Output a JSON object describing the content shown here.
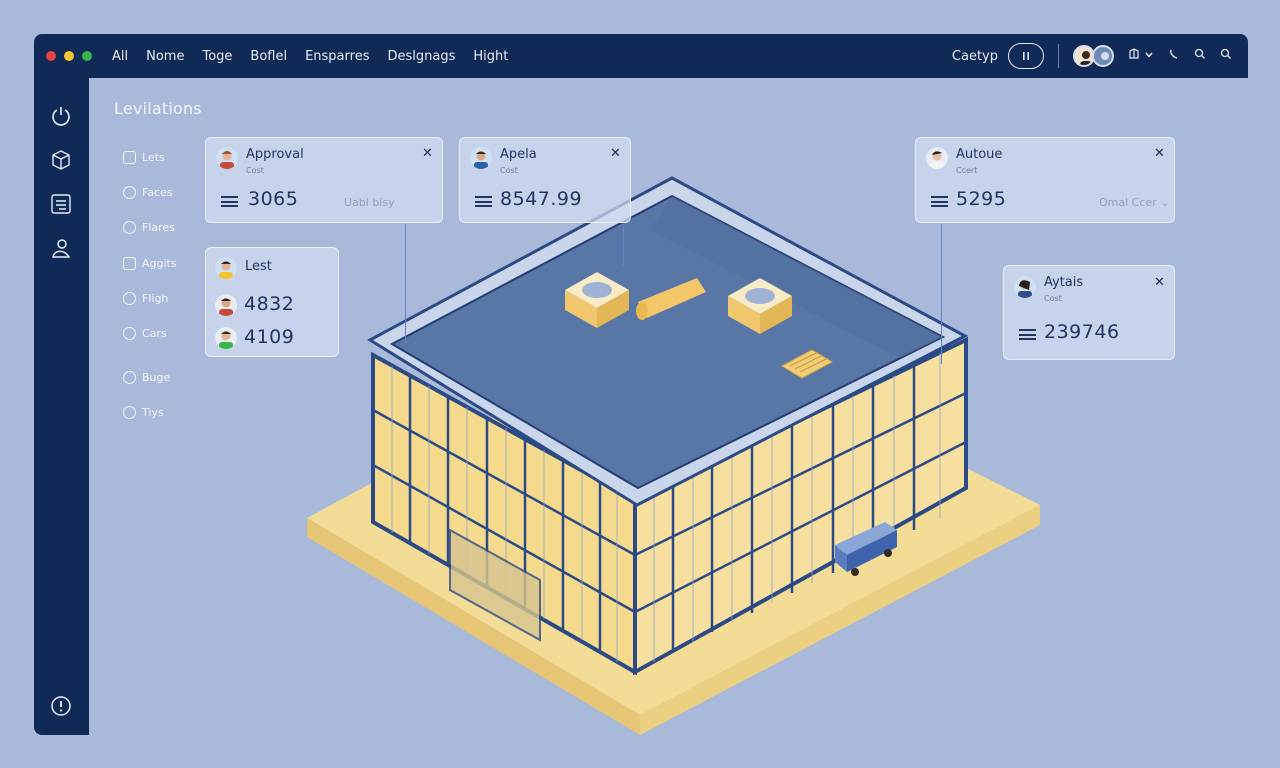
{
  "window": {
    "traffic_lights": [
      "#e2453c",
      "#f2c530",
      "#39b54a"
    ]
  },
  "topnav": {
    "items": [
      "All",
      "Nome",
      "Toge",
      "Boflel",
      "Ensparres",
      "Deslgnags",
      "Hight"
    ]
  },
  "toolbar": {
    "label": "Caetyp",
    "pause_icon": "pause-icon",
    "icons": [
      "grid-icon",
      "chevron-down-icon",
      "phone-icon",
      "search-icon",
      "search-icon"
    ]
  },
  "sidebar": {
    "icons": [
      "power-icon",
      "cube-icon",
      "layers-icon",
      "user-icon"
    ],
    "bottom_icon": "info-icon"
  },
  "panel": {
    "title": "Levilations",
    "items": [
      {
        "label": "Lets",
        "icon": "square-icon"
      },
      {
        "label": "Faces",
        "icon": "circle-icon"
      },
      {
        "label": "Flares",
        "icon": "circle-icon"
      },
      {
        "label": "Aggits",
        "icon": "square-icon"
      },
      {
        "label": "Fligh",
        "icon": "circle-icon"
      },
      {
        "label": "Cars",
        "icon": "circle-icon"
      },
      {
        "label": "Buge",
        "icon": "circle-icon"
      },
      {
        "label": "Tiys",
        "icon": "circle-icon"
      }
    ]
  },
  "cards": {
    "approval": {
      "name": "Approval",
      "sub": "Cost",
      "value": "3065",
      "faint": "Uabl bisy"
    },
    "apela": {
      "name": "Apela",
      "sub": "Cost",
      "value": "8547.99"
    },
    "autoue": {
      "name": "Autoue",
      "sub": "Ccert",
      "value": "5295",
      "faint": "Omal Ccer"
    },
    "aytais": {
      "name": "Aytais",
      "sub": "Cost",
      "value": "239746"
    },
    "lest": {
      "name": "Lest",
      "values": [
        "4832",
        "4109"
      ]
    }
  },
  "colors": {
    "background": "#a9b9da",
    "chrome": "#0f2a56",
    "building_glass": "#f5d98d",
    "building_frame": "#2b4a86",
    "roof": "#5876a6",
    "base": "#f3dc96"
  }
}
